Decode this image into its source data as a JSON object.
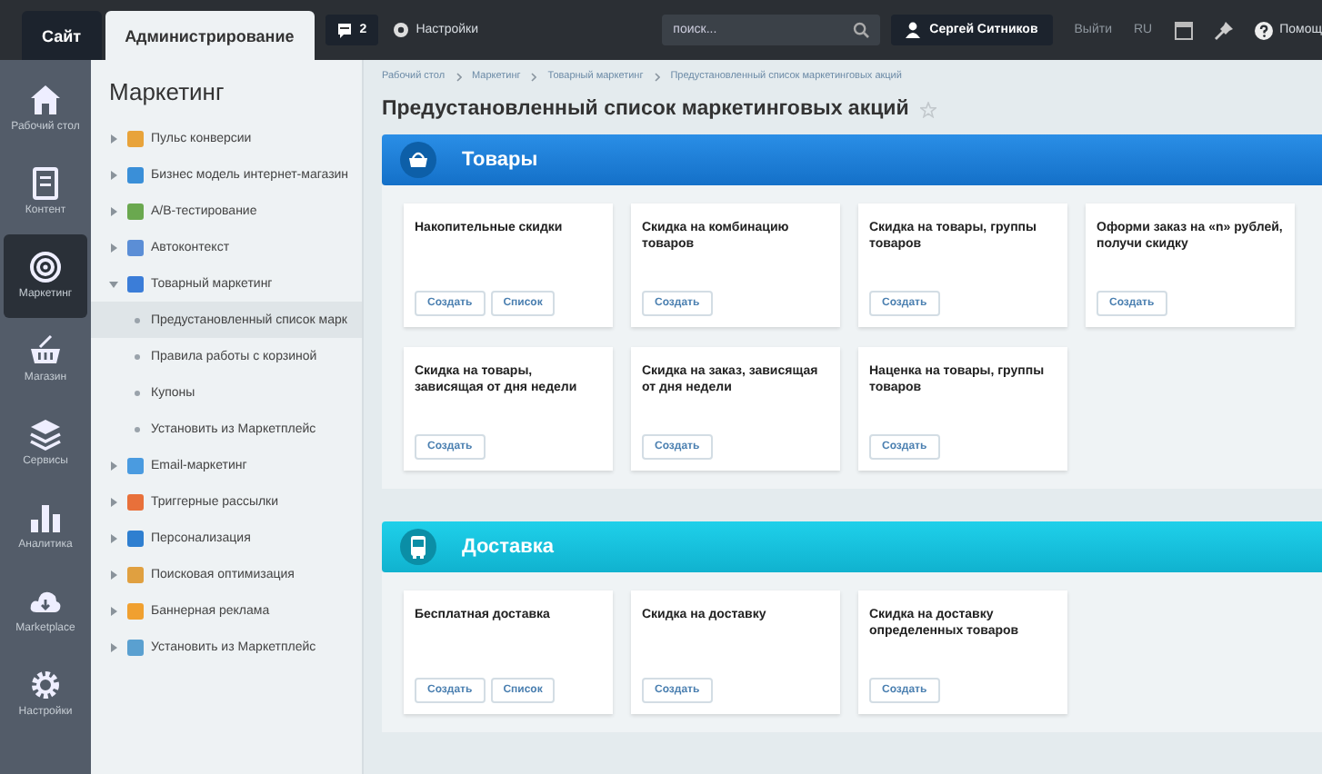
{
  "top_bar": {
    "tabs": [
      {
        "label": "Сайт",
        "selected": false
      },
      {
        "label": "Администрирование",
        "selected": true
      }
    ],
    "notifications": {
      "count": "2"
    },
    "settings": {
      "label": "Настройки"
    },
    "search": {
      "placeholder": "поиск..."
    },
    "user": {
      "name": "Сергей Ситников"
    },
    "logout": "Выйти",
    "language": "RU",
    "help": "Помощ"
  },
  "rail": [
    {
      "label": "Рабочий стол",
      "selected": false
    },
    {
      "label": "Контент",
      "selected": false
    },
    {
      "label": "Маркетинг",
      "selected": true
    },
    {
      "label": "Магазин",
      "selected": false
    },
    {
      "label": "Сервисы",
      "selected": false
    },
    {
      "label": "Аналитика",
      "selected": false
    },
    {
      "label": "Marketplace",
      "selected": false
    },
    {
      "label": "Настройки",
      "selected": false
    }
  ],
  "menu": {
    "title": "Маркетинг",
    "items": [
      {
        "label": "Пульс конверсии",
        "color": "#e8a33a",
        "expanded": false,
        "selected": false
      },
      {
        "label": "Бизнес модель интернет-магазин",
        "color": "#3a8fd8",
        "expanded": false,
        "selected": false
      },
      {
        "label": "A/B-тестирование",
        "color": "#6aa84f",
        "expanded": false,
        "selected": false
      },
      {
        "label": "Автоконтекст",
        "color": "#5b8ed6",
        "expanded": false,
        "selected": false
      },
      {
        "label": "Товарный маркетинг",
        "color": "#3b7dd8",
        "expanded": true,
        "selected": false,
        "children": [
          {
            "label": "Предустановленный список марк",
            "selected": true
          },
          {
            "label": "Правила работы с корзиной",
            "selected": false
          },
          {
            "label": "Купоны",
            "selected": false
          },
          {
            "label": "Установить из Маркетплейс",
            "selected": false
          }
        ]
      },
      {
        "label": "Email-маркетинг",
        "color": "#4a9be0",
        "expanded": false,
        "selected": false
      },
      {
        "label": "Триггерные рассылки",
        "color": "#e8703a",
        "expanded": false,
        "selected": false
      },
      {
        "label": "Персонализация",
        "color": "#2f7fd0",
        "expanded": false,
        "selected": false
      },
      {
        "label": "Поисковая оптимизация",
        "color": "#e0a040",
        "expanded": false,
        "selected": false
      },
      {
        "label": "Баннерная реклама",
        "color": "#f0a030",
        "expanded": false,
        "selected": false
      },
      {
        "label": "Установить из Маркетплейс",
        "color": "#5aa0d0",
        "expanded": false,
        "selected": false
      }
    ]
  },
  "breadcrumbs": [
    "Рабочий стол",
    "Маркетинг",
    "Товарный маркетинг",
    "Предустановленный список маркетинговых акций"
  ],
  "page_title": "Предустановленный список маркетинговых акций",
  "sections": [
    {
      "title": "Товары",
      "kind": "goods",
      "cards": [
        {
          "title": "Накопительные скидки",
          "buttons": [
            "Создать",
            "Список"
          ]
        },
        {
          "title": "Скидка на комбинацию товаров",
          "buttons": [
            "Создать"
          ]
        },
        {
          "title": "Скидка на товары, группы товаров",
          "buttons": [
            "Создать"
          ]
        },
        {
          "title": "Оформи заказ на «n» рублей, получи скидку",
          "buttons": [
            "Создать"
          ]
        },
        {
          "title": "Скидка на товары, зависящая от дня недели",
          "buttons": [
            "Создать"
          ]
        },
        {
          "title": "Скидка на заказ, зависящая от дня недели",
          "buttons": [
            "Создать"
          ]
        },
        {
          "title": "Наценка на товары, группы товаров",
          "buttons": [
            "Создать"
          ]
        }
      ]
    },
    {
      "title": "Доставка",
      "kind": "delivery",
      "cards": [
        {
          "title": "Бесплатная доставка",
          "buttons": [
            "Создать",
            "Список"
          ]
        },
        {
          "title": "Скидка на доставку",
          "buttons": [
            "Создать"
          ]
        },
        {
          "title": "Скидка на доставку определенных товаров",
          "buttons": [
            "Создать"
          ]
        }
      ]
    }
  ]
}
